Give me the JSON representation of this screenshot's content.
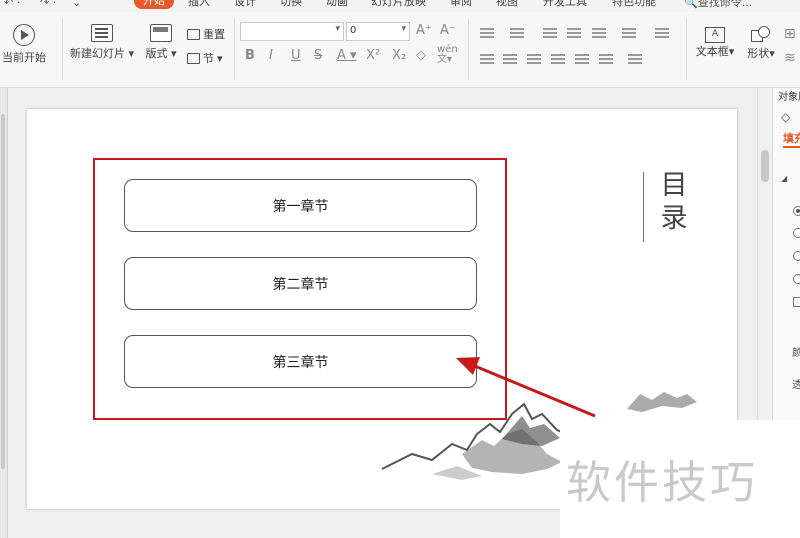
{
  "menu": {
    "tabs": [
      "开始",
      "插入",
      "设计",
      "切换",
      "动画",
      "幻灯片放映",
      "审阅",
      "视图",
      "开发工具",
      "特色功能"
    ],
    "active_tab": "开始",
    "search_label": "查找命令..."
  },
  "ribbon": {
    "from_current": "当前开始",
    "new_slide": "新建幻灯片",
    "layout": "版式",
    "reset": "重置",
    "section": "节",
    "font_size": "0",
    "text_box": "文本框",
    "shape": "形状"
  },
  "slide": {
    "chapters": [
      "第一章节",
      "第二章节",
      "第三章节"
    ],
    "toc_title_1": "目",
    "toc_title_2": "录"
  },
  "panel": {
    "title": "对象属",
    "fill_tab": "填充",
    "color_label": "颜",
    "transparency_label": "透"
  },
  "watermark": "软件技巧",
  "colors": {
    "accent": "#e8582a",
    "highlight_frame": "#c41a1a"
  }
}
